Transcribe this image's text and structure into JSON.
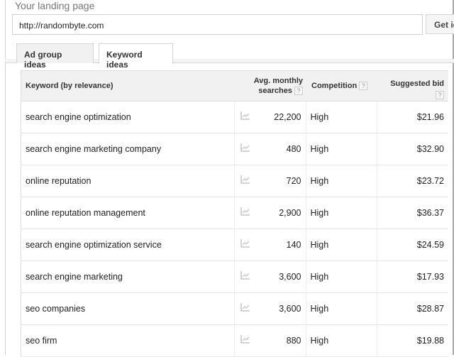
{
  "landing": {
    "label": "Your landing page",
    "url": "http://randombyte.com",
    "get_button": "Get ideas"
  },
  "tabs": [
    {
      "label": "Ad group ideas",
      "active": false
    },
    {
      "label": "Keyword ideas",
      "active": true
    }
  ],
  "table": {
    "headers": {
      "keyword": "Keyword (by relevance)",
      "searches": "Avg. monthly searches",
      "competition": "Competition",
      "bid": "Suggested bid",
      "help": "?"
    },
    "rows": [
      {
        "keyword": "search engine optimization",
        "searches": "22,200",
        "competition": "High",
        "bid": "$21.96"
      },
      {
        "keyword": "search engine marketing company",
        "searches": "480",
        "competition": "High",
        "bid": "$32.90"
      },
      {
        "keyword": "online reputation",
        "searches": "720",
        "competition": "High",
        "bid": "$23.72"
      },
      {
        "keyword": "online reputation management",
        "searches": "2,900",
        "competition": "High",
        "bid": "$36.37"
      },
      {
        "keyword": "search engine optimization service",
        "searches": "140",
        "competition": "High",
        "bid": "$24.59"
      },
      {
        "keyword": "search engine marketing",
        "searches": "3,600",
        "competition": "High",
        "bid": "$17.93"
      },
      {
        "keyword": "seo companies",
        "searches": "3,600",
        "competition": "High",
        "bid": "$28.87"
      },
      {
        "keyword": "seo firm",
        "searches": "880",
        "competition": "High",
        "bid": "$19.88"
      }
    ]
  }
}
